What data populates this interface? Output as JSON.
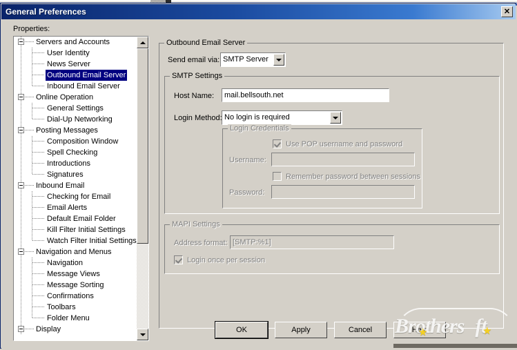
{
  "window": {
    "title": "General Preferences",
    "close_label": "✕"
  },
  "left_panel": {
    "label": "Properties:",
    "tree": [
      {
        "label": "Servers and Accounts",
        "level": 0,
        "expanded": true
      },
      {
        "label": "User Identity",
        "level": 1
      },
      {
        "label": "News Server",
        "level": 1
      },
      {
        "label": "Outbound Email Server",
        "level": 1,
        "selected": true
      },
      {
        "label": "Inbound Email Server",
        "level": 1,
        "last": true
      },
      {
        "label": "Online Operation",
        "level": 0,
        "expanded": true
      },
      {
        "label": "General Settings",
        "level": 1
      },
      {
        "label": "Dial-Up Networking",
        "level": 1,
        "last": true
      },
      {
        "label": "Posting Messages",
        "level": 0,
        "expanded": true
      },
      {
        "label": "Composition Window",
        "level": 1
      },
      {
        "label": "Spell Checking",
        "level": 1
      },
      {
        "label": "Introductions",
        "level": 1
      },
      {
        "label": "Signatures",
        "level": 1,
        "last": true
      },
      {
        "label": "Inbound Email",
        "level": 0,
        "expanded": true
      },
      {
        "label": "Checking for Email",
        "level": 1
      },
      {
        "label": "Email Alerts",
        "level": 1
      },
      {
        "label": "Default Email Folder",
        "level": 1
      },
      {
        "label": "Kill Filter Initial Settings",
        "level": 1
      },
      {
        "label": "Watch Filter Initial Settings",
        "level": 1,
        "last": true
      },
      {
        "label": "Navigation and Menus",
        "level": 0,
        "expanded": true
      },
      {
        "label": "Navigation",
        "level": 1
      },
      {
        "label": "Message Views",
        "level": 1
      },
      {
        "label": "Message Sorting",
        "level": 1
      },
      {
        "label": "Confirmations",
        "level": 1
      },
      {
        "label": "Toolbars",
        "level": 1
      },
      {
        "label": "Folder Menu",
        "level": 1,
        "last": true
      },
      {
        "label": "Display",
        "level": 0,
        "expanded": true
      }
    ]
  },
  "outbound_group": {
    "legend": "Outbound Email Server",
    "send_via_label": "Send email via:",
    "send_via_value": "SMTP Server"
  },
  "smtp_group": {
    "legend": "SMTP Settings",
    "host_label": "Host Name:",
    "host_value": "mail.bellsouth.net",
    "login_method_label": "Login Method:",
    "login_method_value": "No login is required"
  },
  "credentials_group": {
    "legend": "Login Credentials",
    "use_pop_label": "Use POP username and password",
    "use_pop_checked": true,
    "username_label": "Username:",
    "username_value": "",
    "remember_label": "Remember password between sessions",
    "remember_checked": false,
    "password_label": "Password:",
    "password_value": ""
  },
  "mapi_group": {
    "legend": "MAPI Settings",
    "address_format_label": "Address format:",
    "address_format_value": "[SMTP:%1]",
    "login_once_label": "Login once per session",
    "login_once_checked": true
  },
  "buttons": {
    "ok": "OK",
    "apply": "Apply",
    "cancel": "Cancel",
    "help": "Help"
  },
  "watermark": {
    "text_a": "B",
    "text_b": "rothers",
    "text_c": "ft",
    "star": "★"
  },
  "colors": {
    "title_start": "#0a246a",
    "title_end": "#a6caf0",
    "face": "#d4d0c8",
    "selection": "#000080",
    "disabled_text": "#808080"
  }
}
